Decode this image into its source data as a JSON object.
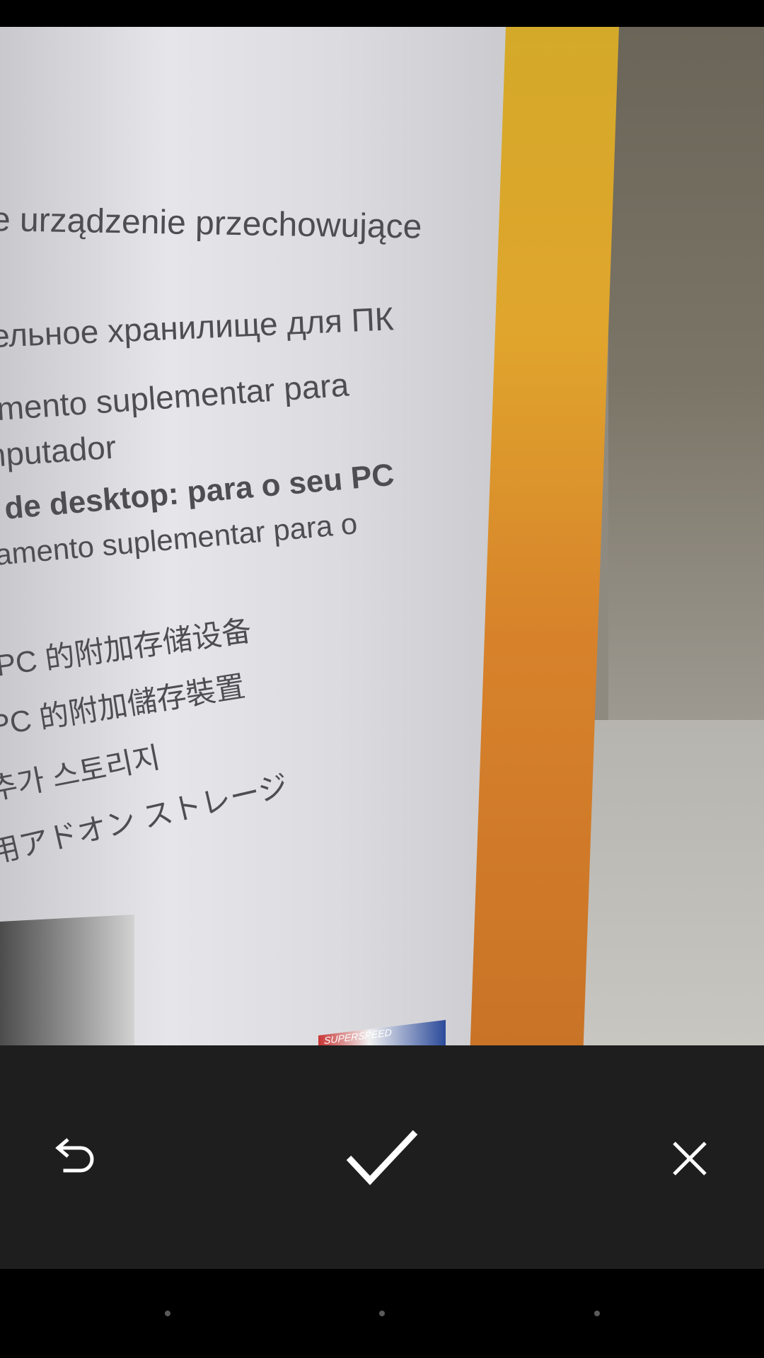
{
  "preview": {
    "box_text": [
      "e urządzenie przechowujące",
      "ельное хранилище для ПК",
      "amento suplementar para",
      "mputador",
      "e de desktop: para o seu PC",
      "hamento suplementar para o",
      "PC 的附加存储设备",
      "PC 的附加儲存裝置",
      "추가 스토리지",
      "用アドオン ストレージ"
    ],
    "badge_text": "SUPERSPEED"
  },
  "controls": {
    "undo_icon": "undo-icon",
    "confirm_icon": "check-icon",
    "cancel_icon": "close-icon",
    "icon_color": "#ffffff",
    "background": "#1e1e1e"
  },
  "nav": {
    "items": [
      "back",
      "home",
      "recents"
    ]
  }
}
